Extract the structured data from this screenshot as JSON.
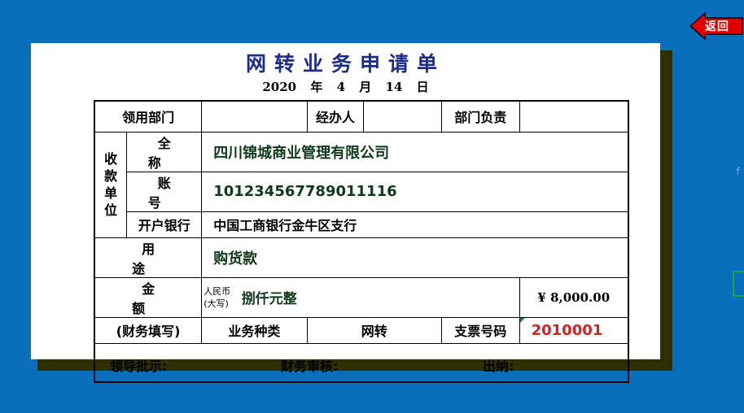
{
  "nav": {
    "back_label": "返回"
  },
  "edge": {
    "glyph": "f"
  },
  "form": {
    "title": "网转业务申请单",
    "date": {
      "year": "2020",
      "year_unit": "年",
      "month": "4",
      "month_unit": "月",
      "day": "14",
      "day_unit": "日"
    },
    "row1": {
      "dept_label": "领用部门",
      "dept_value": "",
      "handler_label": "经办人",
      "handler_value": "",
      "head_label": "部门负责",
      "head_value": ""
    },
    "payee": {
      "side_label": [
        "收",
        "款",
        "单",
        "位"
      ],
      "name_label": "全 称",
      "name_value": "四川锦城商业管理有限公司",
      "account_label": "账 号",
      "account_value": "101234567789011116",
      "bank_label": "开户银行",
      "bank_value": "中国工商银行金牛区支行"
    },
    "purpose": {
      "label": "用 途",
      "value": "购货款"
    },
    "amount": {
      "label": "金 额",
      "rmb_line1": "人民币",
      "rmb_line2": "(大写)",
      "words": "捌仟元整",
      "figure": "¥ 8,000.00"
    },
    "finance": {
      "label": "(财务填写)",
      "type_label": "业务种类",
      "type_value": "网转",
      "cheque_label": "支票号码",
      "cheque_value": "2010001"
    },
    "signatures": {
      "leader": "领导批示:",
      "finance_review": "财务审核:",
      "cashier": "出纳:"
    }
  },
  "colors": {
    "background": "#0a6fba",
    "title": "#1a2c8c",
    "cheque": "#d42222",
    "back_button": "#e00000"
  }
}
